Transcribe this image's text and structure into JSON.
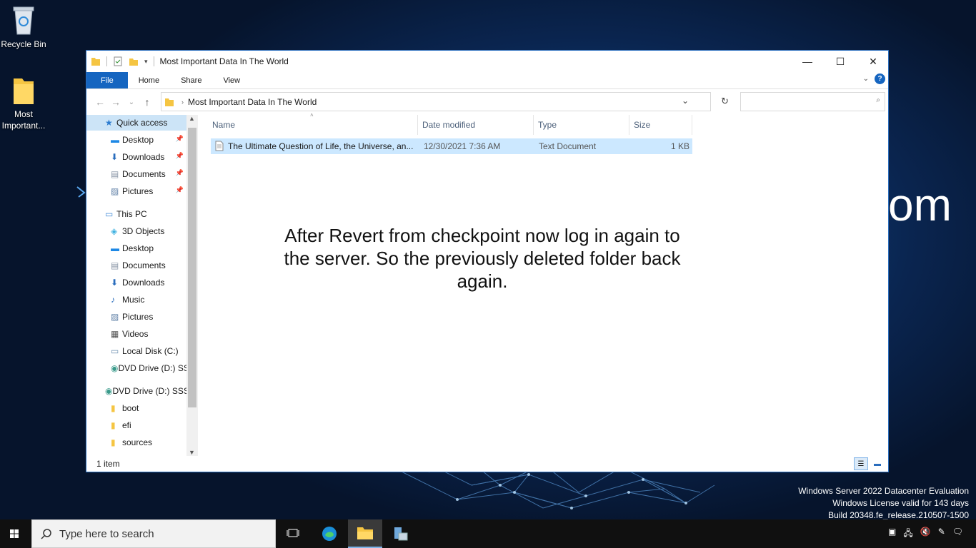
{
  "desktop": {
    "icons": [
      {
        "label": "Recycle Bin"
      },
      {
        "label": "Most Important..."
      }
    ],
    "bg_text": "om",
    "watermark_lines": [
      "Windows Server 2022 Datacenter Evaluation",
      "Windows License valid for 143 days",
      "Build 20348.fe_release.210507-1500"
    ]
  },
  "window": {
    "title": "Most Important Data In The World",
    "ribbon_tabs": [
      "File",
      "Home",
      "Share",
      "View"
    ],
    "address": "Most Important Data In The World",
    "search_placeholder": ""
  },
  "nav": {
    "items": [
      {
        "label": "Quick access",
        "icon": "star-icon",
        "pinned": false
      },
      {
        "label": "Desktop",
        "icon": "desktop-icon",
        "pinned": true
      },
      {
        "label": "Downloads",
        "icon": "download-icon",
        "pinned": true
      },
      {
        "label": "Documents",
        "icon": "document-icon",
        "pinned": true
      },
      {
        "label": "Pictures",
        "icon": "picture-icon",
        "pinned": true
      },
      {
        "label": "This PC",
        "icon": "computer-icon",
        "pinned": false
      },
      {
        "label": "3D Objects",
        "icon": "cube-icon",
        "pinned": false
      },
      {
        "label": "Desktop",
        "icon": "desktop-icon",
        "pinned": false
      },
      {
        "label": "Documents",
        "icon": "document-icon",
        "pinned": false
      },
      {
        "label": "Downloads",
        "icon": "download-icon",
        "pinned": false
      },
      {
        "label": "Music",
        "icon": "music-icon",
        "pinned": false
      },
      {
        "label": "Pictures",
        "icon": "picture-icon",
        "pinned": false
      },
      {
        "label": "Videos",
        "icon": "video-icon",
        "pinned": false
      },
      {
        "label": "Local Disk (C:)",
        "icon": "disk-icon",
        "pinned": false
      },
      {
        "label": "DVD Drive (D:) SS",
        "icon": "dvd-icon",
        "pinned": false
      },
      {
        "label": "DVD Drive (D:) SSS",
        "icon": "dvd-icon",
        "pinned": false
      },
      {
        "label": "boot",
        "icon": "folder-icon",
        "pinned": false
      },
      {
        "label": "efi",
        "icon": "folder-icon",
        "pinned": false
      },
      {
        "label": "sources",
        "icon": "folder-icon",
        "pinned": false
      }
    ]
  },
  "columns": [
    "Name",
    "Date modified",
    "Type",
    "Size"
  ],
  "files": [
    {
      "name": "The Ultimate Question of Life, the Universe, an...",
      "date": "12/30/2021 7:36 AM",
      "type": "Text Document",
      "size": "1 KB"
    }
  ],
  "overlay_text": "After Revert from checkpoint now log in again to the server. So the previously deleted folder back again.",
  "status": {
    "count": "1 item"
  },
  "taskbar": {
    "search_placeholder": "Type here to search"
  },
  "colors": {
    "accent": "#1565c0",
    "selection": "#cce8ff"
  }
}
